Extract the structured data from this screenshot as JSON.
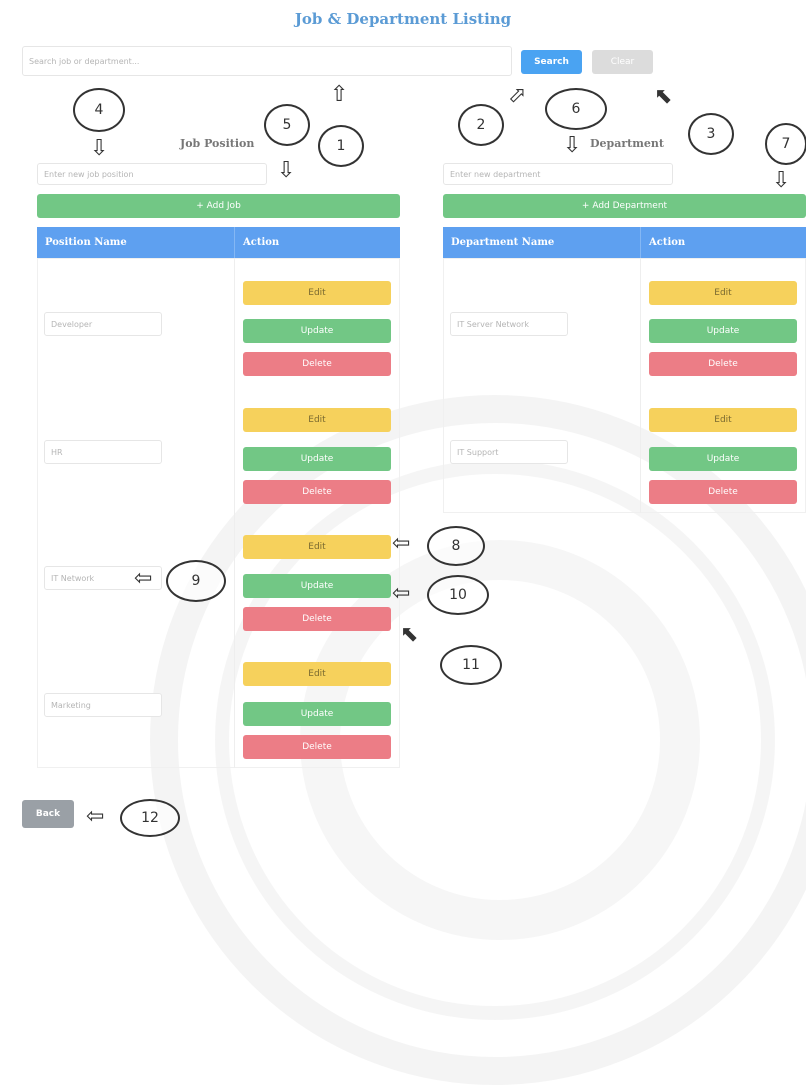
{
  "title": "Job & Department Listing",
  "search": {
    "placeholder": "Search job or department...",
    "search_label": "Search",
    "clear_label": "Clear"
  },
  "job": {
    "label": "Job Position",
    "input_placeholder": "Enter new job position",
    "add_label": "+ Add Job",
    "col_name": "Position Name",
    "col_action": "Action",
    "rows": [
      "Developer",
      "HR",
      "IT Network",
      "Marketing"
    ]
  },
  "department": {
    "label": "Department",
    "input_placeholder": "Enter new department",
    "add_label": "+ Add Department",
    "col_name": "Department Name",
    "col_action": "Action",
    "rows": [
      "IT Server Network",
      "IT Support"
    ]
  },
  "actions": {
    "edit": "Edit",
    "update": "Update",
    "delete": "Delete"
  },
  "back_label": "Back",
  "callouts": [
    "1",
    "2",
    "3",
    "4",
    "5",
    "6",
    "7",
    "8",
    "9",
    "10",
    "11",
    "12"
  ],
  "arrows": {
    "up": "⇧",
    "down": "⇩",
    "left": "⇦",
    "up_right": "⬀",
    "up_left": "⬉"
  },
  "colors": {
    "primary": "#4aa3f2",
    "success": "#72c785",
    "warning": "#f6d15c",
    "danger": "#ec7d86",
    "header": "#5ea0f0"
  }
}
